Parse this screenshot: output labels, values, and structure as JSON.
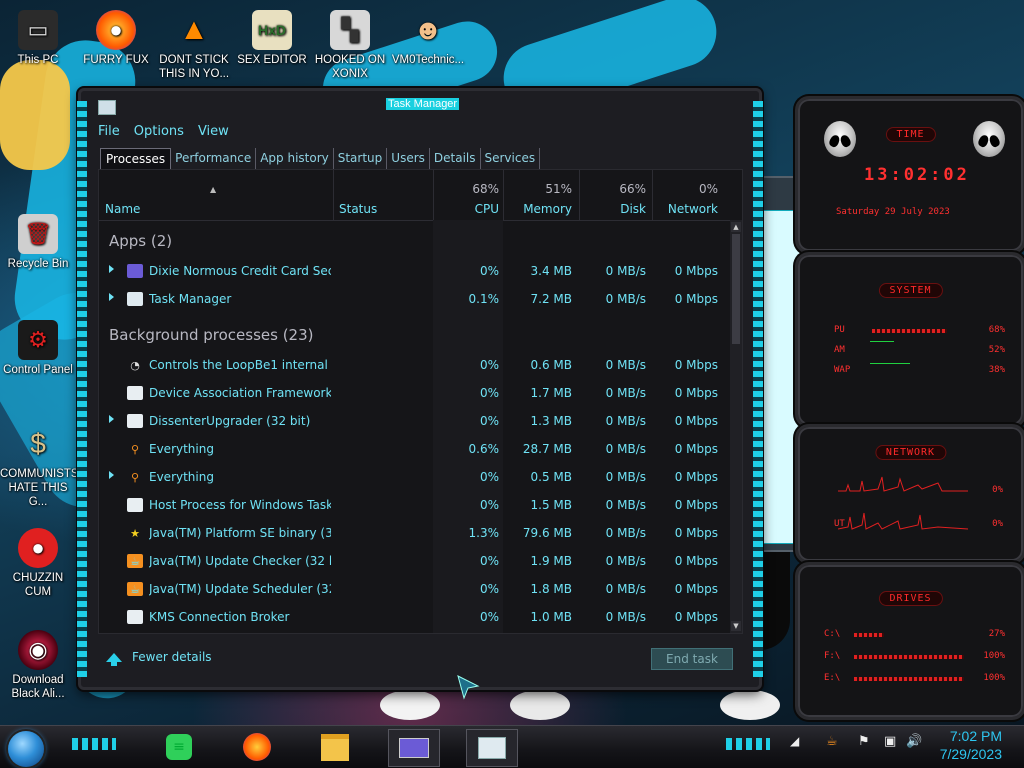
{
  "desktop": {
    "icons": [
      {
        "label": "This PC"
      },
      {
        "label": "FURRY FUX"
      },
      {
        "label": "DONT STICK THIS IN YO..."
      },
      {
        "label": "SEX EDITOR"
      },
      {
        "label": "HOOKED ON XONIX"
      },
      {
        "label": "VM0Technic..."
      },
      {
        "label": "Recycle Bin"
      },
      {
        "label": "Control Panel"
      },
      {
        "label": "COMMUNISTS HATE THIS G..."
      },
      {
        "label": "CHUZZIN CUM"
      },
      {
        "label": "Download Black Ali..."
      }
    ]
  },
  "task_manager": {
    "title": "Task Manager",
    "menu": [
      "File",
      "Options",
      "View"
    ],
    "tabs": [
      "Processes",
      "Performance",
      "App history",
      "Startup",
      "Users",
      "Details",
      "Services"
    ],
    "active_tab": "Processes",
    "columns": {
      "name": "Name",
      "status": "Status",
      "cpu": {
        "label": "CPU",
        "pct": "68%"
      },
      "memory": {
        "label": "Memory",
        "pct": "51%"
      },
      "disk": {
        "label": "Disk",
        "pct": "66%"
      },
      "network": {
        "label": "Network",
        "pct": "0%"
      }
    },
    "groups": {
      "apps": "Apps (2)",
      "background": "Background processes (23)"
    },
    "apps": [
      {
        "name": "Dixie Normous Credit Card Secu...",
        "cpu": "0%",
        "memory": "3.4 MB",
        "disk": "0 MB/s",
        "network": "0 Mbps",
        "expandable": true,
        "icon": "card-app-icon"
      },
      {
        "name": "Task Manager",
        "cpu": "0.1%",
        "memory": "7.2 MB",
        "disk": "0 MB/s",
        "network": "0 Mbps",
        "expandable": true,
        "icon": "task-manager-icon"
      }
    ],
    "background": [
      {
        "name": "Controls the LoopBe1 internal ...",
        "cpu": "0%",
        "memory": "0.6 MB",
        "disk": "0 MB/s",
        "network": "0 Mbps",
        "expandable": false,
        "icon": "loopbe-icon"
      },
      {
        "name": "Device Association Framework ...",
        "cpu": "0%",
        "memory": "1.7 MB",
        "disk": "0 MB/s",
        "network": "0 Mbps",
        "expandable": false,
        "icon": "window-icon"
      },
      {
        "name": "DissenterUpgrader (32 bit)",
        "cpu": "0%",
        "memory": "1.3 MB",
        "disk": "0 MB/s",
        "network": "0 Mbps",
        "expandable": true,
        "icon": "window-icon"
      },
      {
        "name": "Everything",
        "cpu": "0.6%",
        "memory": "28.7 MB",
        "disk": "0 MB/s",
        "network": "0 Mbps",
        "expandable": false,
        "icon": "magnifier-icon"
      },
      {
        "name": "Everything",
        "cpu": "0%",
        "memory": "0.5 MB",
        "disk": "0 MB/s",
        "network": "0 Mbps",
        "expandable": true,
        "icon": "magnifier-icon"
      },
      {
        "name": "Host Process for Windows Tasks",
        "cpu": "0%",
        "memory": "1.5 MB",
        "disk": "0 MB/s",
        "network": "0 Mbps",
        "expandable": false,
        "icon": "window-icon"
      },
      {
        "name": "Java(TM) Platform SE binary (32...",
        "cpu": "1.3%",
        "memory": "79.6 MB",
        "disk": "0 MB/s",
        "network": "0 Mbps",
        "expandable": false,
        "icon": "star-icon"
      },
      {
        "name": "Java(TM) Update Checker (32 bit)",
        "cpu": "0%",
        "memory": "1.9 MB",
        "disk": "0 MB/s",
        "network": "0 Mbps",
        "expandable": false,
        "icon": "java-icon"
      },
      {
        "name": "Java(TM) Update Scheduler (32 ...",
        "cpu": "0%",
        "memory": "1.8 MB",
        "disk": "0 MB/s",
        "network": "0 Mbps",
        "expandable": false,
        "icon": "java-icon"
      },
      {
        "name": "KMS Connection Broker",
        "cpu": "0%",
        "memory": "1.0 MB",
        "disk": "0 MB/s",
        "network": "0 Mbps",
        "expandable": false,
        "icon": "window-icon"
      }
    ],
    "footer": {
      "fewer_details": "Fewer details",
      "end_task": "End task"
    }
  },
  "widgets": {
    "time": {
      "title": "TIME",
      "clock": "13:02:02",
      "date": "Saturday 29 July 2023"
    },
    "system": {
      "title": "SYSTEM",
      "rows": [
        {
          "label": "PU",
          "value": "68%",
          "fill": 0.68
        },
        {
          "label": "AM",
          "value": "52%",
          "fill": 0.52
        },
        {
          "label": "WAP",
          "value": "38%",
          "fill": 0.38
        }
      ]
    },
    "network": {
      "title": "NETWORK",
      "rows": [
        {
          "label": "",
          "value": "0%"
        },
        {
          "label": "UT",
          "value": "0%"
        }
      ]
    },
    "drives": {
      "title": "DRIVES",
      "rows": [
        {
          "label": "C:\\",
          "value": "27%",
          "fill": 0.27
        },
        {
          "label": "F:\\",
          "value": "100%",
          "fill": 1.0
        },
        {
          "label": "E:\\",
          "value": "100%",
          "fill": 1.0
        }
      ]
    }
  },
  "taskbar": {
    "clock_time": "7:02 PM",
    "clock_date": "7/29/2023",
    "pinned": [
      "notes-app-icon",
      "firefox-icon",
      "file-explorer-icon",
      "credit-card-app-icon",
      "task-manager-icon"
    ]
  }
}
